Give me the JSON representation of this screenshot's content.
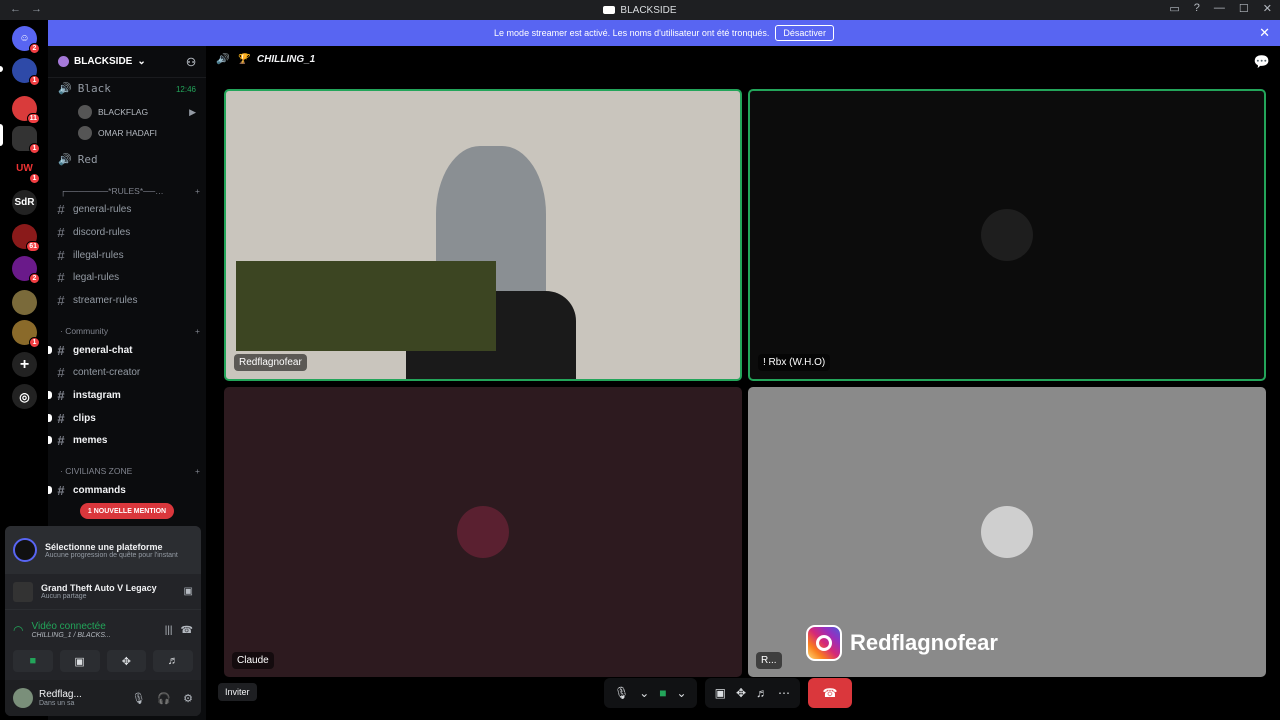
{
  "window": {
    "title": "BLACKSIDE"
  },
  "servers": [
    {
      "name": "discord-home",
      "badge": "2"
    },
    {
      "name": "server-1",
      "badge": "1"
    },
    {
      "name": "server-2",
      "badge": "11"
    },
    {
      "name": "server-3",
      "badge": "1"
    },
    {
      "name": "server-4",
      "badge": "1"
    },
    {
      "name": "SdR",
      "badge": ""
    },
    {
      "name": "server-6",
      "badge": "61"
    },
    {
      "name": "server-7",
      "badge": "2"
    },
    {
      "name": "server-8",
      "badge": ""
    },
    {
      "name": "server-9",
      "badge": "1"
    }
  ],
  "banner": {
    "text": "Le mode streamer est activé. Les noms d'utilisateur ont été tronqués.",
    "button": "Désactiver"
  },
  "guild": {
    "name": "BLACKSIDE"
  },
  "voice": {
    "black": {
      "label": "Black",
      "time": "12:46",
      "users": [
        "BLACKFLAG",
        "OMAR HADAFI"
      ]
    },
    "red": {
      "label": "Red"
    }
  },
  "categories": {
    "rules": "┌───────*RULES*──…",
    "community": "· Community",
    "civilians": "· CIVILIANS ZONE"
  },
  "channels": {
    "rules": [
      "general-rules",
      "discord-rules",
      "illegal-rules",
      "legal-rules",
      "streamer-rules"
    ],
    "community": [
      "general-chat",
      "content-creator",
      "instagram",
      "clips",
      "memes"
    ],
    "civ": [
      "commands"
    ]
  },
  "mention_badge": "1 NOUVELLE MENTION",
  "panel": {
    "quest_title": "Sélectionne une plateforme",
    "quest_sub": "Aucune progression de quête pour l'instant",
    "game_title": "Grand Theft Auto V Legacy",
    "game_sub": "Aucun partage",
    "voice_status": "Vidéo connectée",
    "voice_channel": "CHILLING_1 / BLACKS...",
    "user_name": "Redflag...",
    "user_status": "Dans un sa"
  },
  "main": {
    "channel": "CHILLING_1",
    "invite": "Inviter"
  },
  "tiles": {
    "t1": "Redflagnofear",
    "t2": "! Rbx (W.H.O)",
    "t3": "Claude",
    "t4": "R..."
  },
  "watermark": "Redflagnofear",
  "colors": {
    "accent": "#5865f2",
    "green": "#23a55a",
    "danger": "#da373c"
  }
}
